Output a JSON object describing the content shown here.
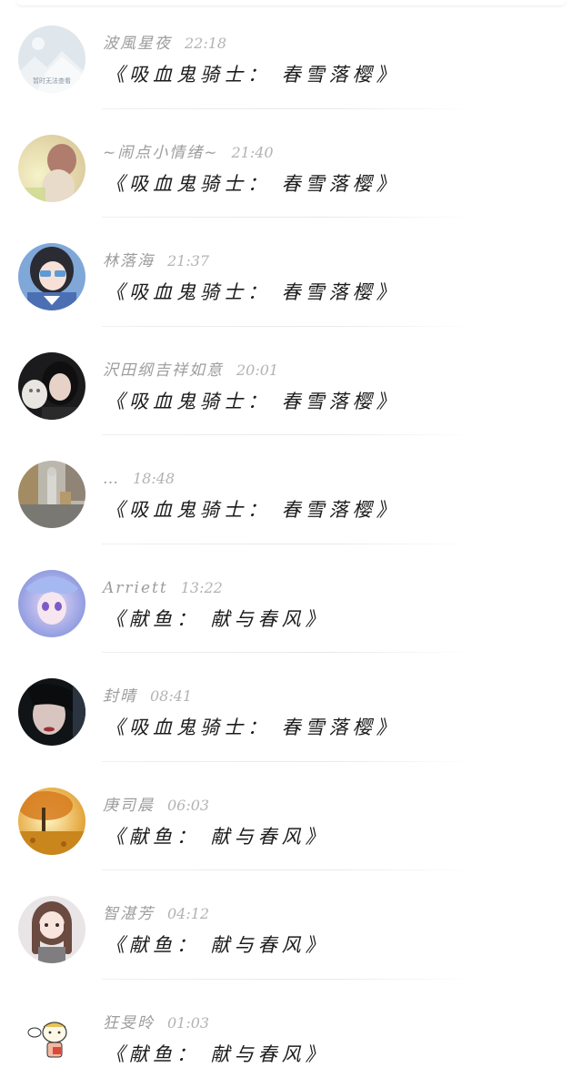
{
  "comments": [
    {
      "username": "波風星夜",
      "time": "22:18",
      "title": "《吸血鬼骑士： 春雪落樱》",
      "avatar_icon": "image-placeholder-avatar",
      "avatar_caption": "暂时无法查看"
    },
    {
      "username": "~闹点小情绪~",
      "time": "21:40",
      "title": "《吸血鬼骑士： 春雪落樱》",
      "avatar_icon": "girl-back-photo-avatar"
    },
    {
      "username": "林落海",
      "time": "21:37",
      "title": "《吸血鬼骑士： 春雪落樱》",
      "avatar_icon": "anime-girl-avatar"
    },
    {
      "username": "沢田纲吉祥如意",
      "time": "20:01",
      "title": "《吸血鬼骑士： 春雪落樱》",
      "avatar_icon": "girl-with-cat-avatar"
    },
    {
      "username": "…",
      "time": "18:48",
      "title": "《吸血鬼骑士： 春雪落樱》",
      "avatar_icon": "street-scene-avatar"
    },
    {
      "username": "Arriett",
      "time": "13:22",
      "title": "《献鱼： 献与春风》",
      "avatar_icon": "anime-blue-girl-avatar"
    },
    {
      "username": "封晴",
      "time": "08:41",
      "title": "《吸血鬼骑士： 春雪落樱》",
      "avatar_icon": "dark-portrait-avatar"
    },
    {
      "username": "庚司晨",
      "time": "06:03",
      "title": "《献鱼： 献与春风》",
      "avatar_icon": "autumn-tree-avatar"
    },
    {
      "username": "智湛芳",
      "time": "04:12",
      "title": "《献鱼： 献与春风》",
      "avatar_icon": "illustrated-girl-avatar"
    },
    {
      "username": "狂旻昤",
      "time": "01:03",
      "title": "《献鱼： 献与春风》",
      "avatar_icon": "cartoon-doodle-avatar"
    }
  ]
}
